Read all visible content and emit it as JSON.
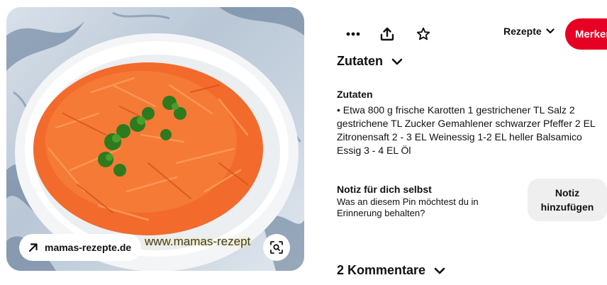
{
  "pin_image": {
    "source_link": "mamas-rezepte.de",
    "watermark": "www.mamas-rezept",
    "source_icon": "arrow-up-right-icon",
    "lens_icon": "visual-search-icon"
  },
  "toolbar": {
    "more_icon": "more-dots-icon",
    "share_icon": "share-icon",
    "favorite_icon": "star-icon",
    "board_label": "Rezepte",
    "save_label": "Merken"
  },
  "ingredients_section": {
    "title": "Zutaten",
    "subtitle": "Zutaten",
    "text": "• Etwa 800 g frische Karotten 1 gestrichener TL Salz 2 gestrichene TL Zucker Gemahlener schwarzer Pfeffer 2 EL Zitronensaft 2 - 3 EL Weinessig 1-2 EL heller Balsamico Essig 3 - 4 EL Öl"
  },
  "note": {
    "title": "Notiz für dich selbst",
    "description": "Was an diesem Pin möchtest du in Erinnerung behalten?",
    "button_label": "Notiz hinzufügen"
  },
  "comments": {
    "title": "2 Kommentare"
  },
  "colors": {
    "save_red": "#e60023",
    "carrot_orange": "#f06a2a",
    "note_button_bg": "#efefef"
  }
}
